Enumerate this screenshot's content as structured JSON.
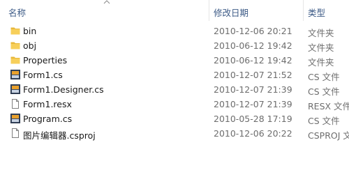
{
  "columns": {
    "name": "名称",
    "date": "修改日期",
    "type": "类型"
  },
  "rows": [
    {
      "name": "bin",
      "date": "2010-12-06 20:21",
      "type": "文件夹",
      "icon": "folder-icon"
    },
    {
      "name": "obj",
      "date": "2010-06-12 19:42",
      "type": "文件夹",
      "icon": "folder-icon"
    },
    {
      "name": "Properties",
      "date": "2010-06-12 19:42",
      "type": "文件夹",
      "icon": "folder-icon"
    },
    {
      "name": "Form1.cs",
      "date": "2010-12-07 21:52",
      "type": "CS 文件",
      "icon": "cs-file-icon"
    },
    {
      "name": "Form1.Designer.cs",
      "date": "2010-12-07 21:39",
      "type": "CS 文件",
      "icon": "cs-file-icon"
    },
    {
      "name": "Form1.resx",
      "date": "2010-12-07 21:39",
      "type": "RESX 文件",
      "icon": "blank-file-icon"
    },
    {
      "name": "Program.cs",
      "date": "2010-05-28 17:19",
      "type": "CS 文件",
      "icon": "cs-file-icon"
    },
    {
      "name": "图片编辑器.csproj",
      "date": "2010-12-06 20:22",
      "type": "CSPROJ 文",
      "icon": "blank-file-icon"
    }
  ]
}
